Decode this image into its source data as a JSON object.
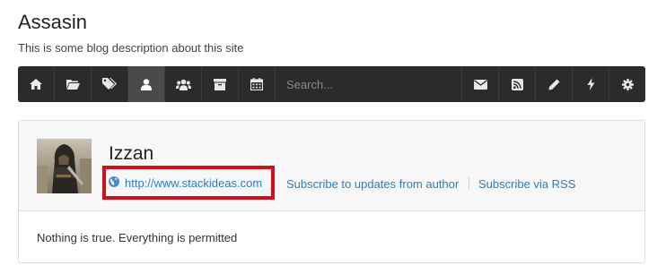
{
  "blog": {
    "title": "Assasin",
    "description": "This is some blog description about this site"
  },
  "toolbar": {
    "left_icons": [
      "home-icon",
      "folder-icon",
      "tags-icon",
      "user-icon",
      "users-icon",
      "archive-icon",
      "calendar-icon"
    ],
    "active": "user-icon",
    "search_placeholder": "Search...",
    "right_icons": [
      "envelope-icon",
      "rss-icon",
      "pencil-icon",
      "bolt-icon",
      "gear-icon"
    ]
  },
  "author": {
    "name": "Izzan",
    "website": "http://www.stackideas.com",
    "subscribe_author": "Subscribe to updates from author",
    "subscribe_rss": "Subscribe via RSS",
    "bio": "Nothing is true. Everything is permitted"
  },
  "colors": {
    "toolbar_bg": "#2b2b2b",
    "link": "#2f7bbf",
    "highlight": "#d0111b"
  }
}
